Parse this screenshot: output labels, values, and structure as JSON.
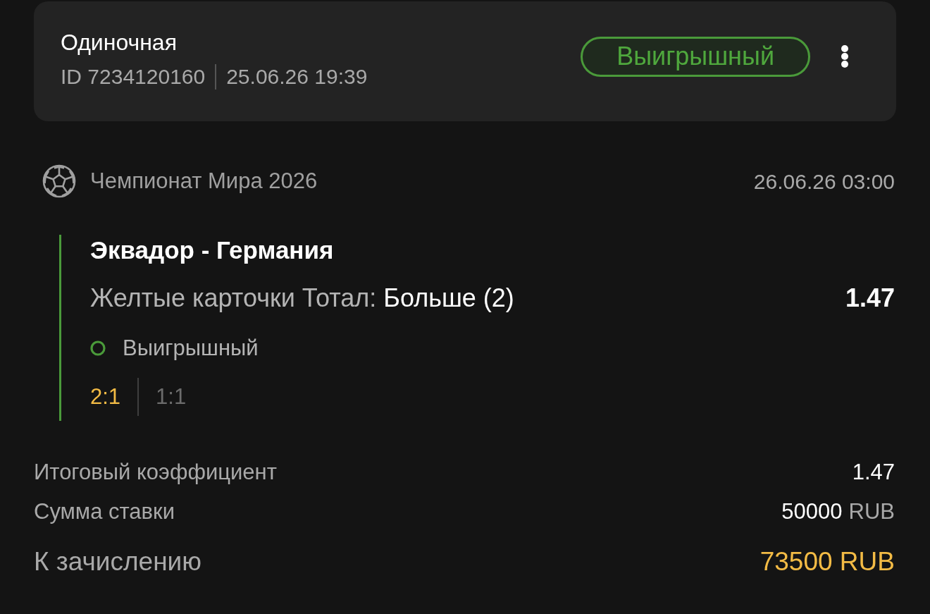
{
  "bet_card": {
    "type": "Одиночная",
    "id": "ID 7234120160",
    "placed_at": "25.06.26 19:39",
    "status_badge": {
      "text": "Выигрышный",
      "kind": "won"
    }
  },
  "event": {
    "league": "Чемпионат Мира 2026",
    "start_time": "26.06.26 03:00",
    "match": "Эквадор - Германия",
    "market": "Желтые карточки Тотал:",
    "selection": "Больше (2)",
    "odds": "1.47",
    "result": {
      "text": "Выигрышный",
      "kind": "won"
    },
    "scores": [
      {
        "text": "2:1",
        "kind": "highlighted"
      },
      {
        "text": "1:1",
        "kind": "plain"
      }
    ]
  },
  "summary": [
    {
      "label": "Итоговый коэффициент",
      "value": "1.47",
      "kind": "plain"
    },
    {
      "label": "Сумма ставки",
      "value": "50000",
      "currency": "RUB",
      "kind": "plain"
    },
    {
      "label": "К зачислению",
      "value": "73500 RUB",
      "kind": "payout"
    }
  ]
}
